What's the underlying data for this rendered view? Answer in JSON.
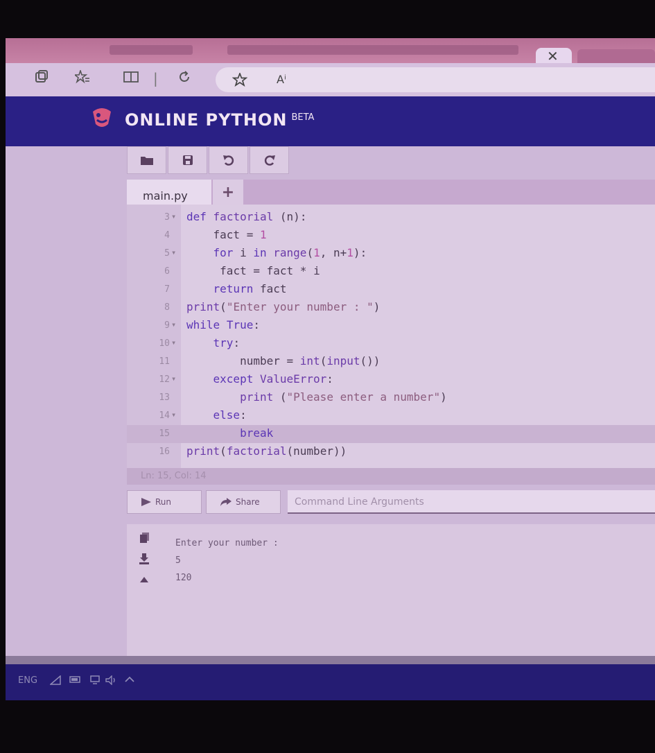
{
  "browser": {
    "tab_close": "✕",
    "toolbar_icons": [
      "tab-actions-icon",
      "favorites-icon",
      "split-screen-icon",
      "refresh-icon"
    ],
    "address_icons": [
      "star-icon",
      "read-aloud-icon"
    ],
    "read_aloud_label": "Aⁱ"
  },
  "site": {
    "brand": "ONLINE PYTHON",
    "badge": "BETA"
  },
  "toolbar": {
    "buttons": [
      "open-folder-icon",
      "save-icon",
      "undo-icon",
      "redo-icon"
    ]
  },
  "tabs": {
    "file": "main.py",
    "add": "+"
  },
  "editor": {
    "lines": [
      {
        "num": "3",
        "fold": "▾",
        "code": "def factorial (n):"
      },
      {
        "num": "4",
        "fold": "",
        "code": "    fact = 1"
      },
      {
        "num": "5",
        "fold": "▾",
        "code": "    for i in range(1, n+1):"
      },
      {
        "num": "6",
        "fold": "",
        "code": "     fact = fact * i"
      },
      {
        "num": "7",
        "fold": "",
        "code": "    return fact"
      },
      {
        "num": "8",
        "fold": "",
        "code": "print(\"Enter your number : \")"
      },
      {
        "num": "9",
        "fold": "▾",
        "code": "while True:"
      },
      {
        "num": "10",
        "fold": "▾",
        "code": "    try:"
      },
      {
        "num": "11",
        "fold": "",
        "code": "        number = int(input())"
      },
      {
        "num": "12",
        "fold": "▾",
        "code": "    except ValueError:"
      },
      {
        "num": "13",
        "fold": "",
        "code": "        print (\"Please enter a number\")"
      },
      {
        "num": "14",
        "fold": "▾",
        "code": "    else:"
      },
      {
        "num": "15",
        "fold": "",
        "code": "        break"
      },
      {
        "num": "16",
        "fold": "",
        "code": "print(factorial(number))"
      }
    ],
    "status": "Ln: 15,  Col: 14"
  },
  "runbar": {
    "run_label": "Run",
    "share_label": "Share",
    "args_placeholder": "Command Line Arguments"
  },
  "output": {
    "lines": [
      "Enter your number :",
      "5",
      "120"
    ]
  },
  "taskbar": {
    "lang": "ENG"
  }
}
